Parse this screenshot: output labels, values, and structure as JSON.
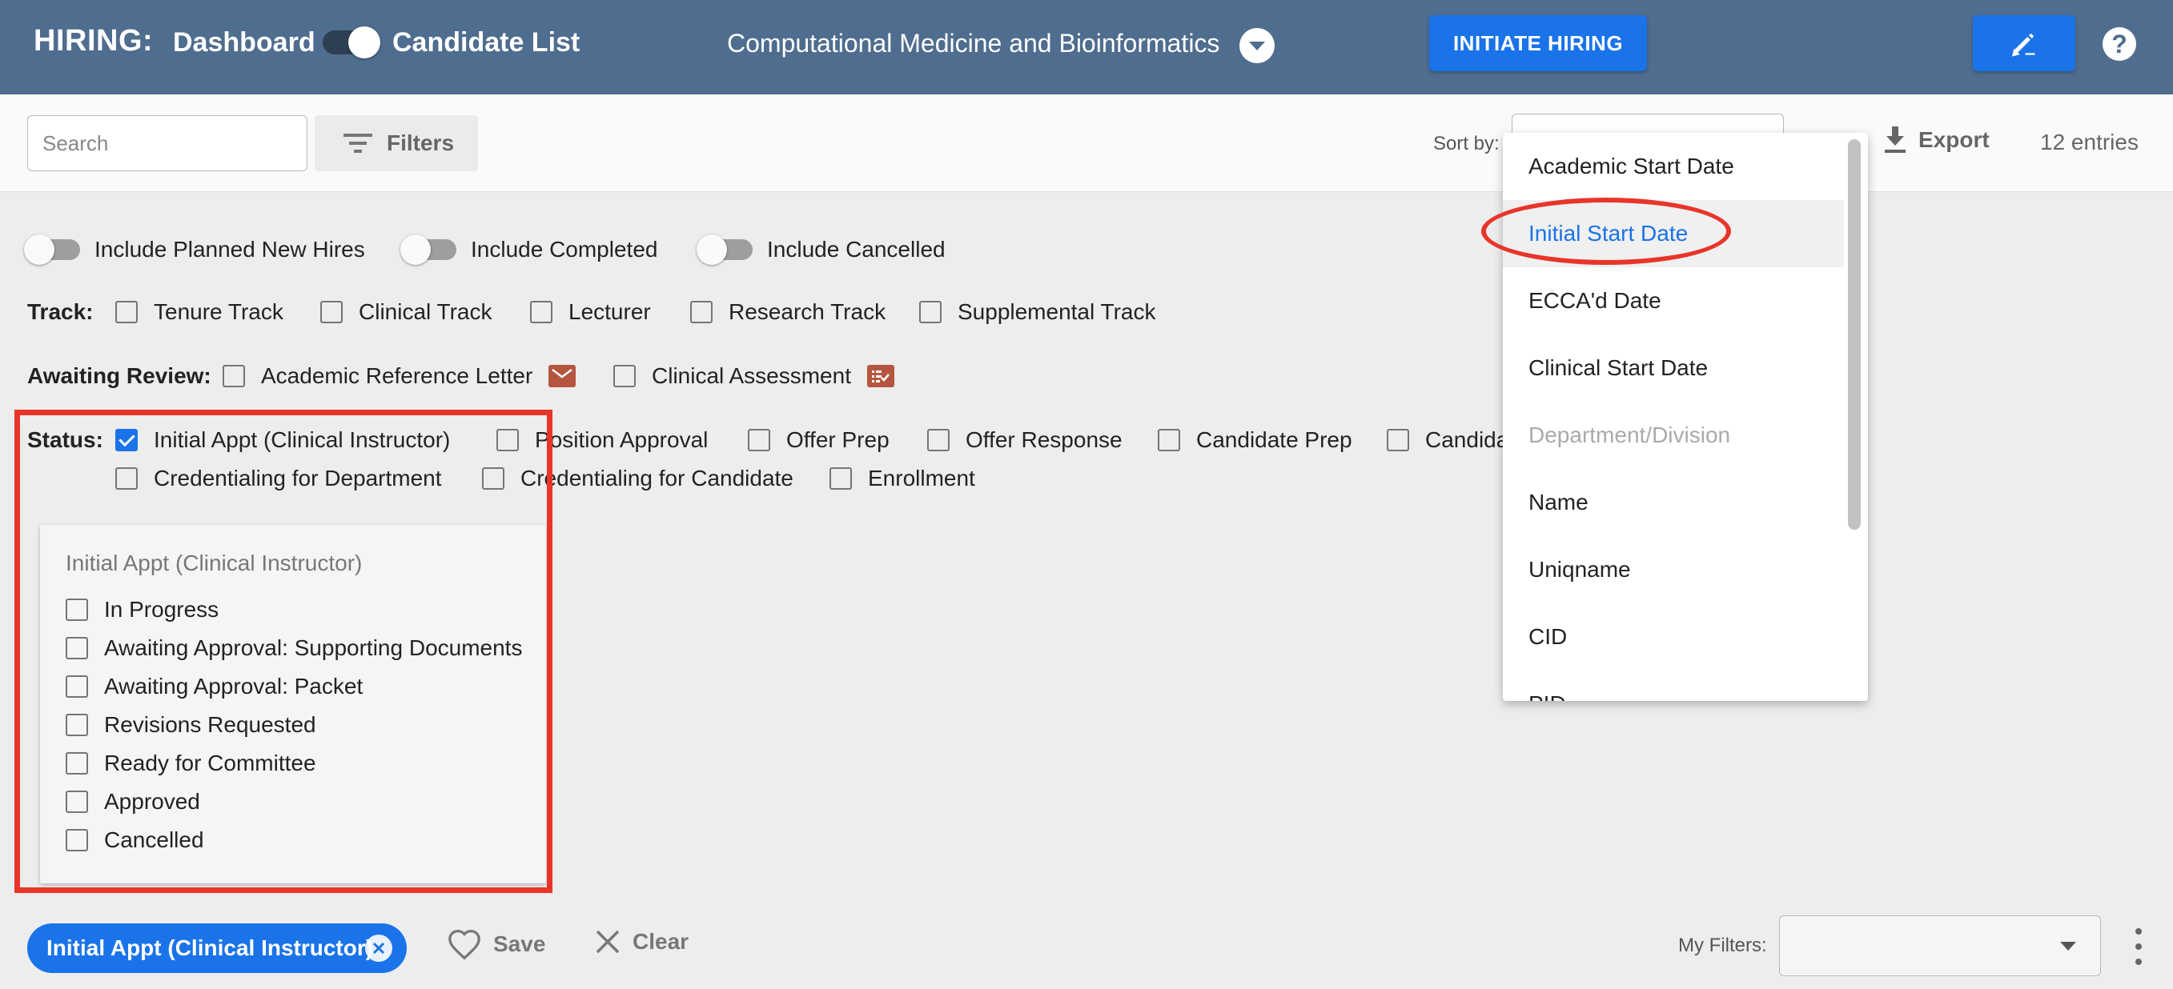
{
  "header": {
    "app_label": "HIRING:",
    "view_dashboard": "Dashboard",
    "view_candidates": "Candidate List",
    "department": "Computational Medicine and Bioinformatics",
    "initiate_button": "INITIATE HIRING",
    "help": "?"
  },
  "toolbar": {
    "search_placeholder": "Search",
    "filters_label": "Filters",
    "sort_by_label": "Sort by:",
    "export_label": "Export",
    "entries": "12 entries"
  },
  "toggles": [
    {
      "label": "Include Planned New Hires",
      "on": false
    },
    {
      "label": "Include Completed",
      "on": false
    },
    {
      "label": "Include Cancelled",
      "on": false
    }
  ],
  "track": {
    "label": "Track:",
    "options": [
      "Tenure Track",
      "Clinical Track",
      "Lecturer",
      "Research Track",
      "Supplemental Track"
    ]
  },
  "awaiting_review": {
    "label": "Awaiting Review:",
    "options": [
      "Academic Reference Letter",
      "Clinical Assessment"
    ]
  },
  "status": {
    "label": "Status:",
    "options": [
      {
        "label": "Initial Appt (Clinical Instructor)",
        "checked": true
      },
      {
        "label": "Position Approval",
        "checked": false
      },
      {
        "label": "Offer Prep",
        "checked": false
      },
      {
        "label": "Offer Response",
        "checked": false
      },
      {
        "label": "Candidate Prep",
        "checked": false
      },
      {
        "label": "Candida",
        "checked": false
      },
      {
        "label": "Credentialing for Department",
        "checked": false
      },
      {
        "label": "Credentialing for Candidate",
        "checked": false
      },
      {
        "label": "Enrollment",
        "checked": false
      }
    ]
  },
  "substatus": {
    "title": "Initial Appt (Clinical Instructor)",
    "options": [
      "In Progress",
      "Awaiting Approval: Supporting Documents",
      "Awaiting Approval: Packet",
      "Revisions Requested",
      "Ready for Committee",
      "Approved",
      "Cancelled"
    ]
  },
  "sort_menu": {
    "items": [
      "Academic Start Date",
      "Initial Start Date",
      "ECCA'd Date",
      "Clinical Start Date",
      "Department/Division",
      "Name",
      "Uniqname",
      "CID",
      "PID"
    ],
    "active": "Initial Start Date",
    "disabled": "Department/Division"
  },
  "bottom": {
    "chip_label": "Initial Appt (Clinical Instructor)",
    "save_label": "Save",
    "clear_label": "Clear",
    "my_filters_label": "My Filters:"
  },
  "colors": {
    "header_bg": "#4f6d8e",
    "accent": "#1a73e8",
    "annotation_red": "#e8352a"
  }
}
